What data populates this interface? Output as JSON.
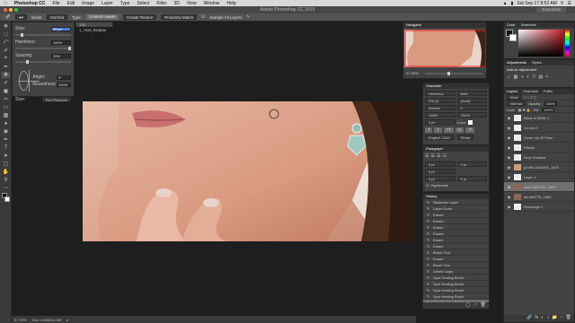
{
  "app": {
    "name": "Photoshop CC",
    "window_title": "Adobe Photoshop CC 2015",
    "workspace": "Essentials"
  },
  "menu": [
    "File",
    "Edit",
    "Image",
    "Layer",
    "Type",
    "Select",
    "Filter",
    "3D",
    "View",
    "Window",
    "Help"
  ],
  "clock": "Sat Sep 17 8:52 AM",
  "options": {
    "mode_label": "Mode:",
    "mode_value": "Normal",
    "type_label": "Type:",
    "type_value": "Content-Aware",
    "create_texture": "Create Texture",
    "proximity": "Proximity Match",
    "sample_all": "Sample All Layers"
  },
  "brush": {
    "size_label": "Size:",
    "size_value": "20 px",
    "hardness_label": "Hardness:",
    "hardness_value": "100%",
    "spacing_label": "Spacing:",
    "spacing_value": "25%",
    "angle_label": "Angle:",
    "angle_value": "0°",
    "roundness_label": "Roundness:",
    "roundness_value": "100%",
    "size_ctrl_label": "Size:",
    "size_ctrl_value": "Pen Pressure"
  },
  "doc_tab": "170-1_7343_RGB/8#",
  "status": {
    "zoom": "57.99%",
    "doc": "Doc: 4.88M/10.0M"
  },
  "navigator": {
    "title": "Navigator",
    "zoom": "57.99%"
  },
  "color": {
    "tabs": [
      "Color",
      "Swatches"
    ],
    "accent": "#c81e2c"
  },
  "adjustments": {
    "tabs": [
      "Adjustments",
      "Styles"
    ],
    "hint": "Add an adjustment"
  },
  "character": {
    "title": "Character",
    "font": "Helvetica Neue",
    "style": "Bold",
    "size": "200 pt",
    "leading": "(Auto)",
    "kerning": "Metrics",
    "tracking": "0",
    "scale_v": "100%",
    "scale_h": "100%",
    "baseline": "0 pt",
    "color_label": "Color:",
    "language": "English: USA",
    "aa": "Sharp"
  },
  "paragraph": {
    "title": "Paragraph",
    "values": [
      "0 pt",
      "0 pt",
      "0 pt",
      "0 pt",
      "0 pt"
    ],
    "hyphenate": "Hyphenate"
  },
  "history": {
    "title": "History",
    "items": [
      "Rasterize Layer",
      "Layer Order",
      "Eraser",
      "Eraser",
      "Eraser",
      "Eraser",
      "Eraser",
      "Eraser",
      "Brush Tool",
      "Eraser",
      "Brush Tool",
      "Delete Layer",
      "Spot Healing Brush",
      "Spot Healing Brush",
      "Spot Healing Brush",
      "Spot Healing Brush",
      "Spot Healing Brush"
    ]
  },
  "layers": {
    "tabs": [
      "Layers",
      "Channels",
      "Paths"
    ],
    "kind": "Kind",
    "blend": "Normal",
    "opacity_label": "Opacity:",
    "opacity": "100%",
    "lock_label": "Lock:",
    "fill_label": "Fill:",
    "fill": "100%",
    "items": [
      {
        "name": "Black & White 1"
      },
      {
        "name": "Curves 1"
      },
      {
        "name": "Cover Up Of Face"
      },
      {
        "name": "Effects"
      },
      {
        "name": "Drop Shadow"
      },
      {
        "name": "profile-1645450_1920"
      },
      {
        "name": "Layer 1"
      },
      {
        "name": "wed-1692230_1920"
      },
      {
        "name": "art-886776_1920"
      },
      {
        "name": "Rectangle 1"
      }
    ]
  }
}
